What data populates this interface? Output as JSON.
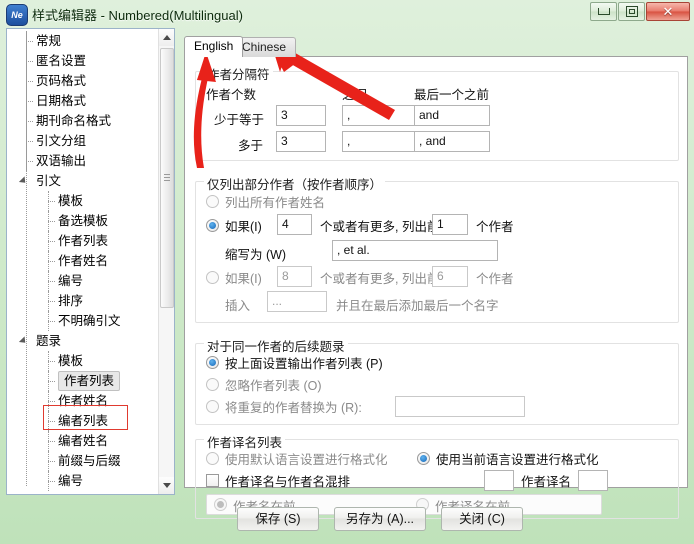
{
  "window": {
    "title": "样式编辑器 - Numbered(Multilingual)",
    "app_icon_text": "Ne",
    "controls": {
      "minimize": "minimize",
      "maximize": "maximize",
      "close": "✕"
    }
  },
  "sidebar": {
    "items": [
      {
        "label": "常规",
        "level": 1,
        "type": "leaf"
      },
      {
        "label": "匿名设置",
        "level": 1,
        "type": "leaf"
      },
      {
        "label": "页码格式",
        "level": 1,
        "type": "leaf"
      },
      {
        "label": "日期格式",
        "level": 1,
        "type": "leaf"
      },
      {
        "label": "期刊命名格式",
        "level": 1,
        "type": "leaf"
      },
      {
        "label": "引文分组",
        "level": 1,
        "type": "leaf"
      },
      {
        "label": "双语输出",
        "level": 1,
        "type": "leaf"
      },
      {
        "label": "引文",
        "level": 1,
        "type": "group"
      },
      {
        "label": "模板",
        "level": 2,
        "type": "leaf"
      },
      {
        "label": "备选模板",
        "level": 2,
        "type": "leaf"
      },
      {
        "label": "作者列表",
        "level": 2,
        "type": "leaf"
      },
      {
        "label": "作者姓名",
        "level": 2,
        "type": "leaf"
      },
      {
        "label": "编号",
        "level": 2,
        "type": "leaf"
      },
      {
        "label": "排序",
        "level": 2,
        "type": "leaf"
      },
      {
        "label": "不明确引文",
        "level": 2,
        "type": "leaf"
      },
      {
        "label": "题录",
        "level": 1,
        "type": "group"
      },
      {
        "label": "模板",
        "level": 2,
        "type": "leaf"
      },
      {
        "label": "作者列表",
        "level": 2,
        "type": "leaf",
        "selected": true
      },
      {
        "label": "作者姓名",
        "level": 2,
        "type": "leaf"
      },
      {
        "label": "编者列表",
        "level": 2,
        "type": "leaf"
      },
      {
        "label": "编者姓名",
        "level": 2,
        "type": "leaf"
      },
      {
        "label": "前缀与后缀",
        "level": 2,
        "type": "leaf"
      },
      {
        "label": "编号",
        "level": 2,
        "type": "leaf"
      }
    ]
  },
  "tabs": [
    {
      "label": "English",
      "active": true
    },
    {
      "label": "Chinese",
      "active": false
    }
  ],
  "separator_group": {
    "title": "作者分隔符",
    "col_count": "作者个数",
    "col_between": "之间",
    "col_before_last": "最后一个之前",
    "rows": [
      {
        "label": "少于等于",
        "count": "3",
        "between": ",",
        "before_last": "and"
      },
      {
        "label": "多于",
        "count": "3",
        "between": ",",
        "before_last": ", and"
      }
    ]
  },
  "partial_group": {
    "title": "仅列出部分作者（按作者顺序）",
    "option_all": "列出所有作者姓名",
    "option_all_selected": false,
    "rule1": {
      "selected": true,
      "prefix": "如果(I)",
      "threshold": "4",
      "middle": "个或者有更多, 列出前",
      "show_count": "1",
      "suffix": "个作者",
      "abbrev_label": "缩写为 (W)",
      "abbrev_value": ", et al."
    },
    "rule2": {
      "selected": false,
      "prefix": "如果(I)",
      "threshold": "8",
      "middle": "个或者有更多, 列出前",
      "show_count": "6",
      "suffix": "个作者",
      "insert_label": "插入",
      "insert_value": "...",
      "insert_suffix": "并且在最后添加最后一个名字"
    }
  },
  "repeat_group": {
    "title": "对于同一作者的后续题录",
    "options": [
      {
        "label": "按上面设置输出作者列表 (P)",
        "selected": true,
        "disabled": false
      },
      {
        "label": "忽略作者列表 (O)",
        "selected": false,
        "disabled": true
      },
      {
        "label": "将重复的作者替换为 (R):",
        "selected": false,
        "disabled": true
      }
    ],
    "replace_value": ""
  },
  "translated_group": {
    "title": "作者译名列表",
    "option_default": "使用默认语言设置进行格式化",
    "option_default_selected": false,
    "option_current": "使用当前语言设置进行格式化",
    "option_current_selected": true,
    "mix_checkbox": "作者译名与作者名混排",
    "mix_checked": false,
    "mix_prefix_value": "",
    "mix_middle_label": "作者译名",
    "mix_suffix_value": "",
    "order_options": [
      {
        "label": "作者名在前",
        "selected": true,
        "disabled": true
      },
      {
        "label": "作者译名在前",
        "selected": false,
        "disabled": true
      }
    ]
  },
  "buttons": {
    "save": "保存 (S)",
    "save_as": "另存为 (A)...",
    "close": "关闭 (C)"
  },
  "annotations": {
    "arrow_color": "#e8221a",
    "arrow_english_target": "English",
    "arrow_chinese_target": "Chinese",
    "highlight_color": "#e03a2f"
  }
}
